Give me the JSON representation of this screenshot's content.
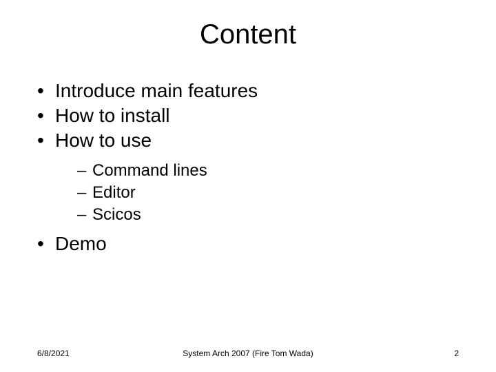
{
  "title": "Content",
  "bullets": {
    "b1": "Introduce main features",
    "b2": "How to install",
    "b3": "How to use",
    "b3_sub": {
      "s1": "Command lines",
      "s2": "Editor",
      "s3": "Scicos"
    },
    "b4": "Demo"
  },
  "footer": {
    "date": "6/8/2021",
    "center": "System Arch 2007  (Fire Tom Wada)",
    "page": "2"
  }
}
